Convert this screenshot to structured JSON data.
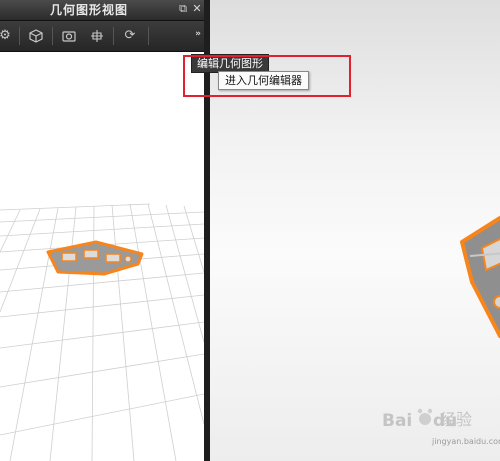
{
  "panel": {
    "title": "几何图形视图",
    "buttons": {
      "float_icon": "restore-icon",
      "close_icon": "close-icon"
    }
  },
  "toolbar": {
    "tools": [
      "settings-gear-icon",
      "box-3d-icon",
      "camera-icon",
      "grid-view-icon",
      "refresh-icon"
    ],
    "expand_icon": "double-chevron-icon"
  },
  "menu": {
    "label": "编辑几何图形"
  },
  "tooltip": {
    "text": "进入几何编辑器"
  },
  "watermark": {
    "brand": "Baidu",
    "text": "经验",
    "url": "jingyan.baidu.com"
  },
  "colors": {
    "accent_orange": "#f7851c",
    "highlight_red": "#e0212f",
    "dark_ui": "#2b2b2b"
  }
}
